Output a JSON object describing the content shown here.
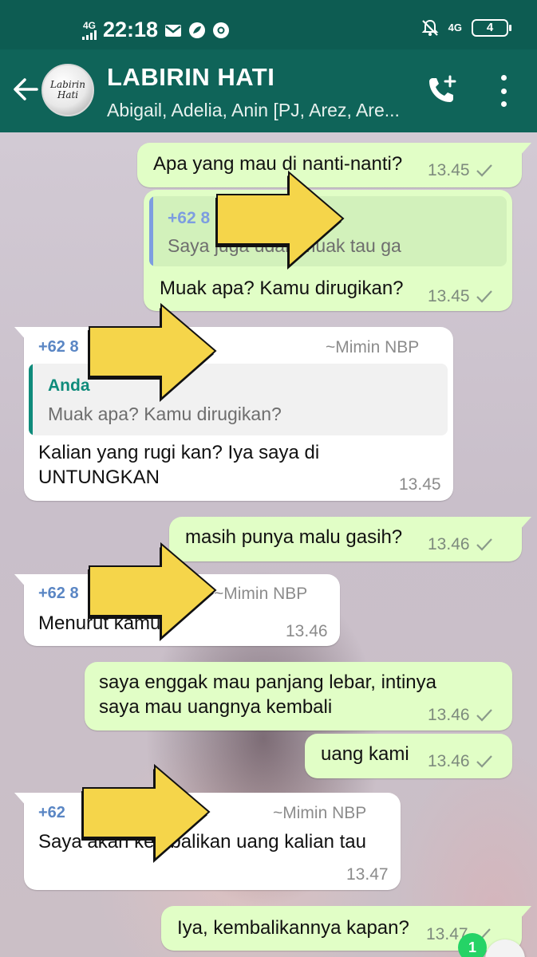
{
  "status_bar": {
    "signal_label": "4G",
    "time": "22:18",
    "network_label": "4G",
    "battery": "4"
  },
  "header": {
    "avatar_line1": "Labirin",
    "avatar_line2": "Hati",
    "title": "LABIRIN HATI",
    "participants": "Abigail, Adelia, Anin [PJ, Arez, Are..."
  },
  "messages": [
    {
      "dir": "out",
      "text": "Apa yang mau di nanti-nanti?",
      "time": "13.45"
    },
    {
      "dir": "out",
      "quote_sender": "+62 8",
      "quote_text": "Saya juga udah muak tau ga",
      "text": "Muak apa? Kamu dirugikan?",
      "time": "13.45"
    },
    {
      "dir": "in",
      "sender": "+62 8",
      "alias": "~Mimin NBP",
      "quote_sender": "Anda",
      "quote_text": "Muak apa? Kamu dirugikan?",
      "text_line1": "Kalian yang rugi kan? Iya saya di",
      "text_line2": "UNTUNGKAN",
      "time": "13.45"
    },
    {
      "dir": "out",
      "text": "masih punya malu gasih?",
      "time": "13.46"
    },
    {
      "dir": "in",
      "sender": "+62 8",
      "alias": "~Mimin NBP",
      "text": "Menurut kamu?",
      "time": "13.46"
    },
    {
      "dir": "out",
      "text_line1": "saya enggak mau panjang lebar, intinya",
      "text_line2": "saya mau uangnya kembali",
      "time": "13.46"
    },
    {
      "dir": "out",
      "text": "uang kami",
      "time": "13.46"
    },
    {
      "dir": "in",
      "sender": "+62",
      "alias": "~Mimin NBP",
      "text": "Saya akan kembalikan uang kalian tau",
      "time": "13.47"
    },
    {
      "dir": "out",
      "text": "Iya, kembalikannya kapan?",
      "time": "13.47"
    }
  ],
  "unread_badge": "1",
  "colors": {
    "header": "#0f6459",
    "status_bar": "#0d5c52",
    "outgoing_bubble": "#e1fec6",
    "incoming_bubble": "#ffffff",
    "arrow_fill": "#f5d54a",
    "quote_bar_blue": "#7d9de0",
    "quote_bar_teal": "#0f8b7b"
  }
}
